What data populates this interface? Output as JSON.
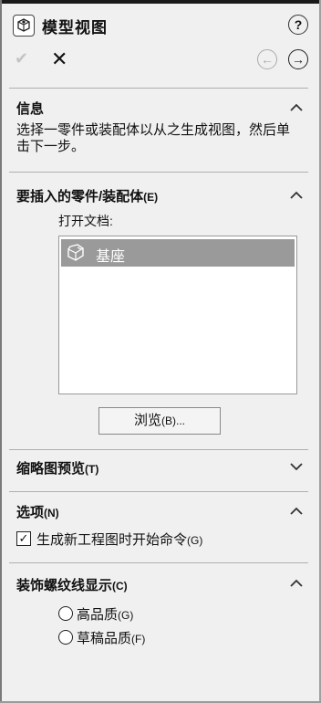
{
  "header": {
    "title": "模型视图",
    "help_icon": "?"
  },
  "actions": {
    "ok_icon": "✔",
    "cancel_icon": "✕",
    "back_icon": "←",
    "next_icon": "→"
  },
  "info": {
    "title": "信息",
    "text": "选择一零件或装配体以从之生成视图，然后单击下一步。"
  },
  "insert_part": {
    "title_main": "要插入的零件/装配体",
    "title_key": "(E)",
    "open_docs_label": "打开文档:",
    "documents": [
      "基座"
    ],
    "browse_main": "浏览",
    "browse_key": "(B)..."
  },
  "thumbnail": {
    "title_main": "缩略图预览",
    "title_key": "(T)"
  },
  "options": {
    "title_main": "选项",
    "title_key": "(N)",
    "checkbox_main": "生成新工程图时开始命令",
    "checkbox_key": "(G)",
    "checkbox_checked": true
  },
  "cosmetic_thread": {
    "title_main": "装饰螺纹线显示",
    "title_key": "(C)",
    "radio1_main": "高品质",
    "radio1_key": "(G)",
    "radio2_main": "草稿品质",
    "radio2_key": "(F)"
  }
}
